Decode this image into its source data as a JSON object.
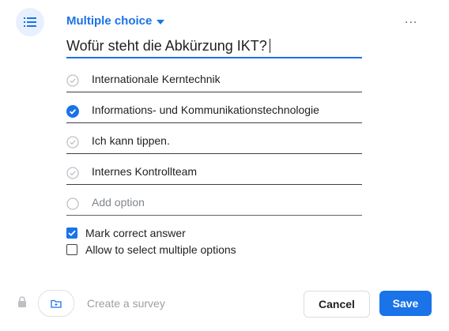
{
  "header": {
    "type_label": "Multiple choice",
    "type_icon": "list-icon",
    "more_icon": "more-horizontal-icon",
    "more_text": "..."
  },
  "question": {
    "text": "Wofür steht die Abkürzung IKT?"
  },
  "options": [
    {
      "label": "Internationale Kerntechnik",
      "selected": false
    },
    {
      "label": "Informations- und Kommunikationstechnologie",
      "selected": true
    },
    {
      "label": "Ich kann tippen.",
      "selected": false
    },
    {
      "label": "Internes Kontrollteam",
      "selected": false
    }
  ],
  "add_option": {
    "placeholder": "Add option"
  },
  "settings": {
    "mark_correct": {
      "label": "Mark correct answer",
      "checked": true
    },
    "multiple": {
      "label": "Allow to select multiple options",
      "checked": false
    }
  },
  "footer": {
    "create_survey": "Create a survey",
    "cancel_label": "Cancel",
    "save_label": "Save"
  },
  "colors": {
    "accent": "#1a73e8",
    "accent_bg": "#e8f0fe",
    "muted": "#9aa0a6"
  }
}
